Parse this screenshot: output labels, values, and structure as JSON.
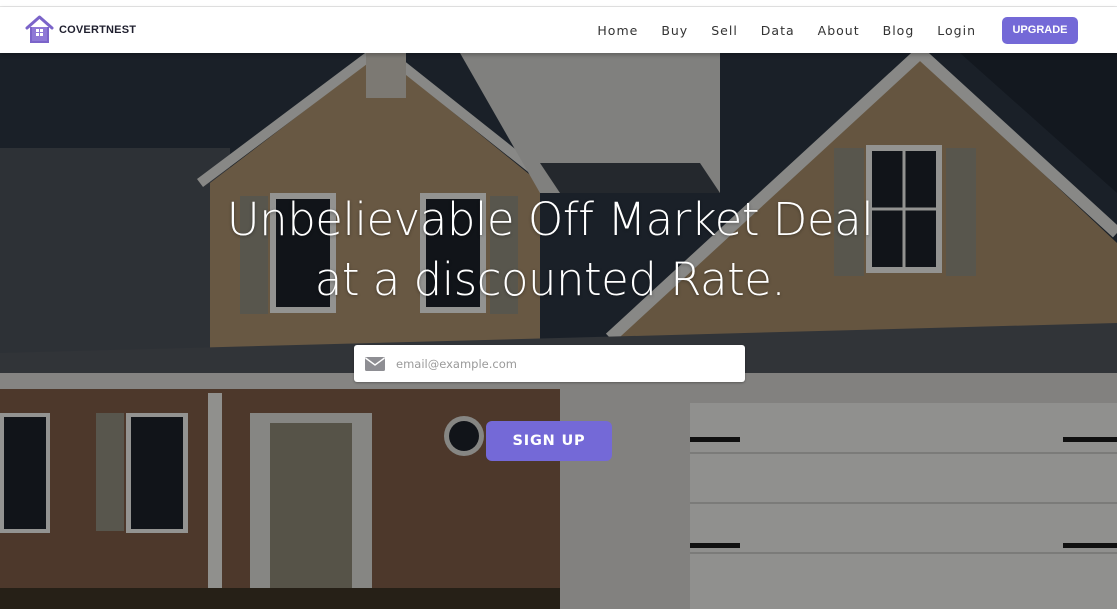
{
  "brand": {
    "name": "COVERTNEST",
    "logo_icon": "house-logo-icon",
    "logo_color": "#7b64c9"
  },
  "nav": {
    "links": [
      {
        "label": "Home"
      },
      {
        "label": "Buy"
      },
      {
        "label": "Sell"
      },
      {
        "label": "Data"
      },
      {
        "label": "About"
      },
      {
        "label": "Blog"
      },
      {
        "label": "Login"
      }
    ],
    "upgrade_label": "UPGRADE"
  },
  "hero": {
    "headline_line1": "Unbelievable Off Market Deal",
    "headline_line2": "at a discounted Rate.",
    "background_icon": "house-photo",
    "email": {
      "icon": "envelope-icon",
      "placeholder": "email@example.com",
      "value": ""
    },
    "signup_label": "SIGN UP"
  },
  "colors": {
    "accent": "#7469d7",
    "navbar_bg": "#ffffff",
    "headline": "#ffffff"
  }
}
